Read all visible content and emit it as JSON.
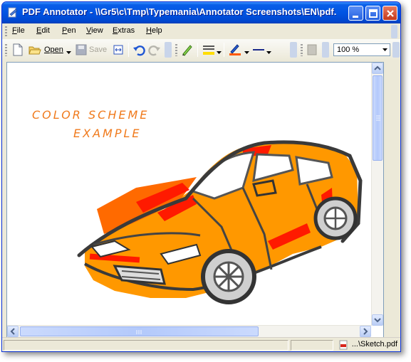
{
  "window": {
    "title": "PDF Annotator - \\\\Gr5\\c\\Tmp\\Typemania\\Annotator Screenshots\\EN\\pdf..."
  },
  "menu": {
    "items": [
      {
        "label": "File",
        "hot": "F",
        "rest": "ile"
      },
      {
        "label": "Edit",
        "hot": "E",
        "rest": "dit"
      },
      {
        "label": "Pen",
        "hot": "P",
        "rest": "en"
      },
      {
        "label": "View",
        "hot": "V",
        "rest": "iew"
      },
      {
        "label": "Extras",
        "hot": "E",
        "rest": "xtras"
      },
      {
        "label": "Help",
        "hot": "H",
        "rest": "elp"
      }
    ]
  },
  "toolbar": {
    "open_label": "Open",
    "save_label": "Save",
    "zoom": "100 %"
  },
  "document": {
    "title_line1": "COLOR SCHEME",
    "title_line2": "EXAMPLE"
  },
  "status": {
    "file": "...\\Sketch.pdf"
  },
  "colors": {
    "accent": "#0054e3",
    "sketch_orange": "#ff8c00",
    "sketch_red": "#ff1a00",
    "highlighter": "#ffdd00",
    "pen_blue": "#1e4fd8"
  }
}
